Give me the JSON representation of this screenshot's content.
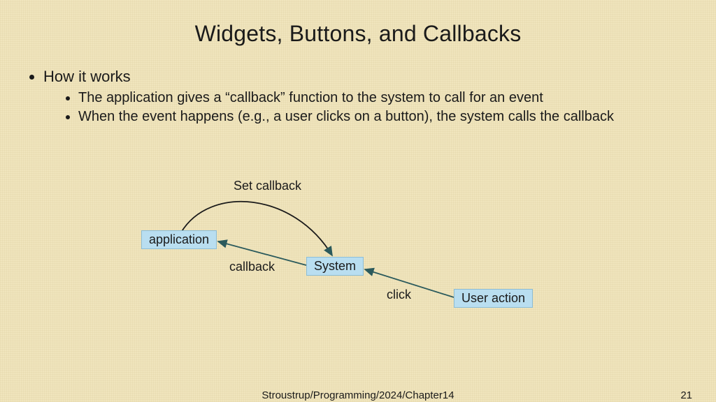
{
  "title": "Widgets, Buttons, and Callbacks",
  "heading": "How it works",
  "bullets": {
    "b1": "The application gives a “callback” function to the system to call for an event",
    "b2": "When the event happens (e.g., a user clicks on a button), the system calls the callback"
  },
  "diagram": {
    "boxes": {
      "application": "application",
      "system": "System",
      "user_action": "User action"
    },
    "labels": {
      "set_callback": "Set callback",
      "callback": "callback",
      "click": "click"
    }
  },
  "footer": {
    "center": "Stroustrup/Programming/2024/Chapter14",
    "page": "21"
  }
}
